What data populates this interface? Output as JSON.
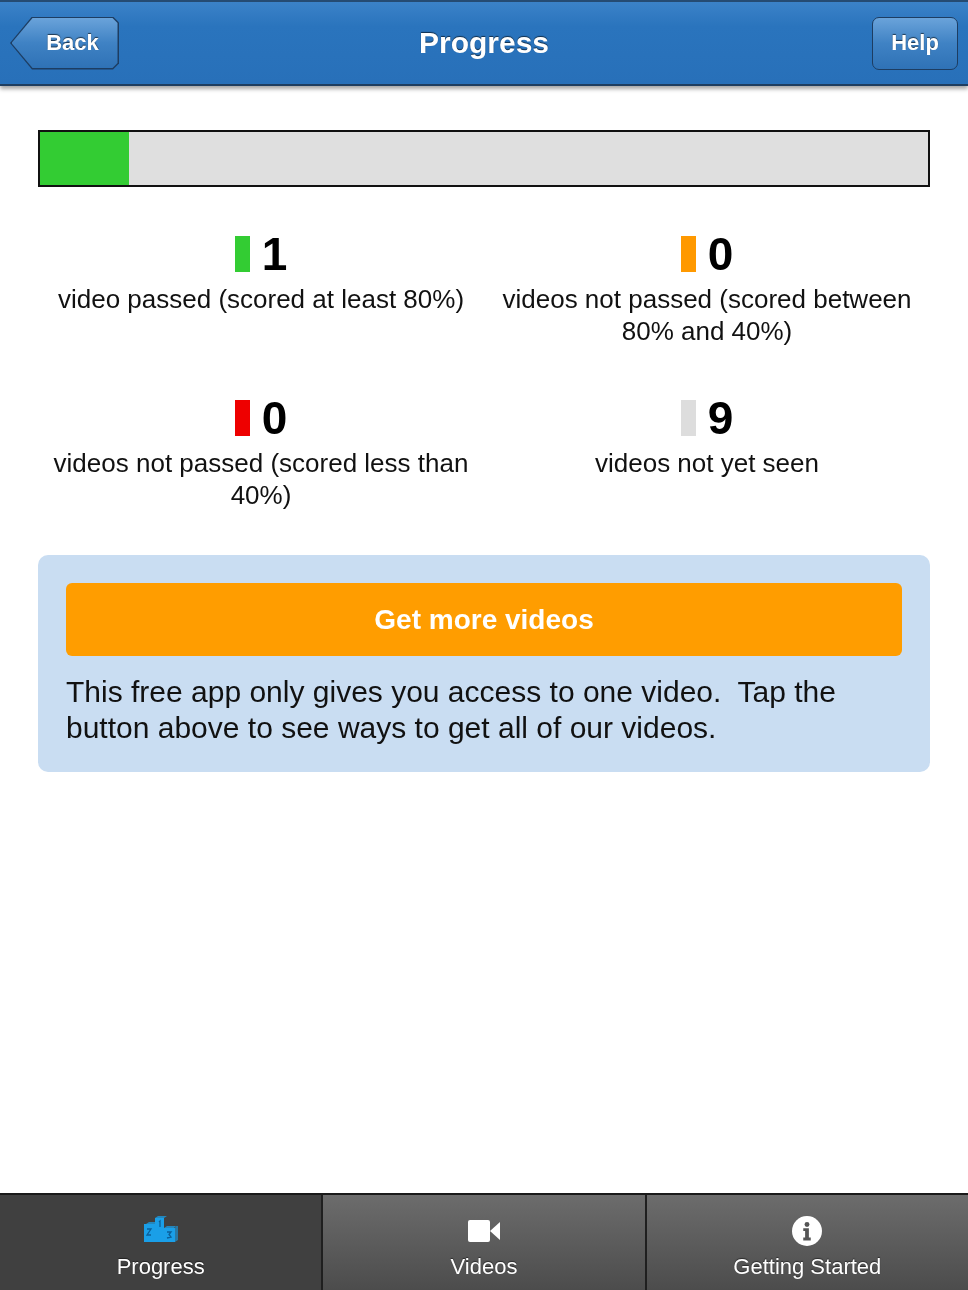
{
  "nav_bar": {
    "back_button": "Back",
    "title": "Progress",
    "help_button": "Help"
  },
  "progress_bar": {
    "level": 0.1
  },
  "stats": [
    {
      "count": "1",
      "label": "video passed (scored at least 80%)",
      "color": "#33cc33"
    },
    {
      "count": "0",
      "label": "videos not passed (scored between 80% and 40%)",
      "color": "#ff9900"
    },
    {
      "count": "0",
      "label": "videos not passed (scored less than 40%)",
      "color": "#ee0000"
    },
    {
      "count": "9",
      "label": "videos not yet seen",
      "color": "#dddddd"
    }
  ],
  "promo": {
    "button": "Get more videos",
    "text": "This free app only gives you access to one video.  Tap the button above to see ways to get all of our videos."
  },
  "tab_bar": [
    {
      "label": "Progress",
      "kind": "podium",
      "selected": true
    },
    {
      "label": "Videos",
      "kind": "video",
      "selected": false
    },
    {
      "label": "Getting Started",
      "kind": "info",
      "selected": false
    }
  ]
}
